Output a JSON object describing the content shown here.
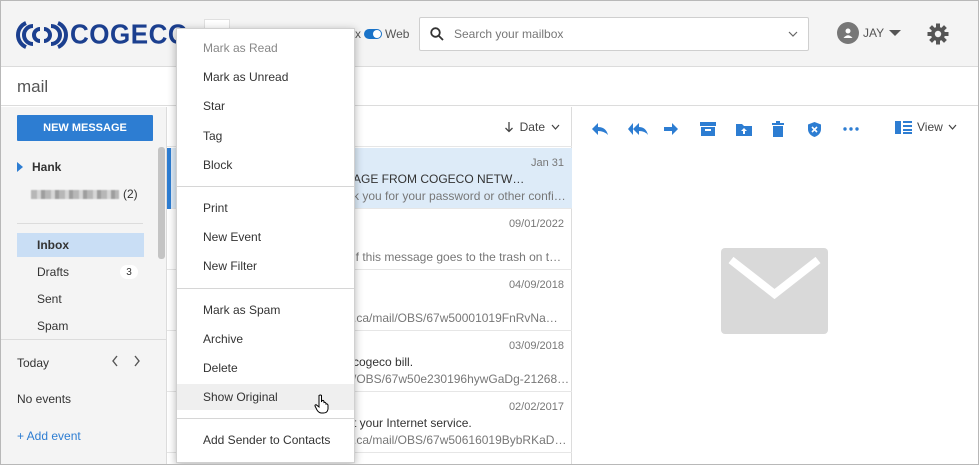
{
  "header": {
    "logo_text": "COGECO",
    "toggle_label_left": "x",
    "toggle_label_right": "Web",
    "search_placeholder": "Search your mailbox",
    "user_name": "JAY",
    "icons": [
      "search-icon",
      "chevron-down-icon",
      "avatar-icon",
      "caret-down-icon",
      "gear-icon"
    ],
    "brand_color": "#1b3f8f"
  },
  "page": {
    "title": "mail"
  },
  "sidebar": {
    "new_message_label": "NEW MESSAGE",
    "account_name": "Hank",
    "sub_account_count": "(2)",
    "folders": [
      {
        "label": "Inbox",
        "active": true,
        "count": ""
      },
      {
        "label": "Drafts",
        "active": false,
        "count": "3"
      },
      {
        "label": "Sent",
        "active": false,
        "count": ""
      },
      {
        "label": "Spam",
        "active": false,
        "count": ""
      }
    ],
    "calendar": {
      "today_label": "Today",
      "no_events": "No events",
      "add_event": "+ Add event"
    },
    "accent_color": "#2d7dd2"
  },
  "message_list": {
    "sort_label": "Date",
    "messages": [
      {
        "date": "Jan 31",
        "subject": "AGE FROM COGECO NETW…",
        "preview": "k you for your password or other confi…",
        "selected": true
      },
      {
        "date": "09/01/2022",
        "subject": "",
        "preview": "if this message goes to the trash on t…",
        "selected": false
      },
      {
        "date": "04/09/2018",
        "subject": "",
        "preview": ".ca/mail/OBS/67w50001019FnRvNa…",
        "selected": false
      },
      {
        "date": "03/09/2018",
        "subject": "cogeco bill.",
        "preview": "/OBS/67w50e230196hywGaDg-21268…",
        "selected": false
      },
      {
        "date": "02/02/2017",
        "subject": "t your Internet service.",
        "preview": ".ca/mail/OBS/67w50616019BybRKaD…",
        "selected": false
      }
    ]
  },
  "reading_pane": {
    "view_label": "View",
    "toolbar_icons": [
      "reply-icon",
      "reply-all-icon",
      "forward-icon",
      "archive-icon",
      "move-folder-icon",
      "delete-icon",
      "shield-icon",
      "more-icon"
    ]
  },
  "context_menu": {
    "groups": [
      [
        "Mark as Read",
        "Mark as Unread",
        "Star",
        "Tag",
        "Block"
      ],
      [
        "Print",
        "New Event",
        "New Filter"
      ],
      [
        "Mark as Spam",
        "Archive",
        "Delete",
        "Show Original"
      ],
      [
        "Add Sender to Contacts"
      ]
    ],
    "disabled_item": "Mark as Read",
    "hovered_item": "Show Original"
  }
}
